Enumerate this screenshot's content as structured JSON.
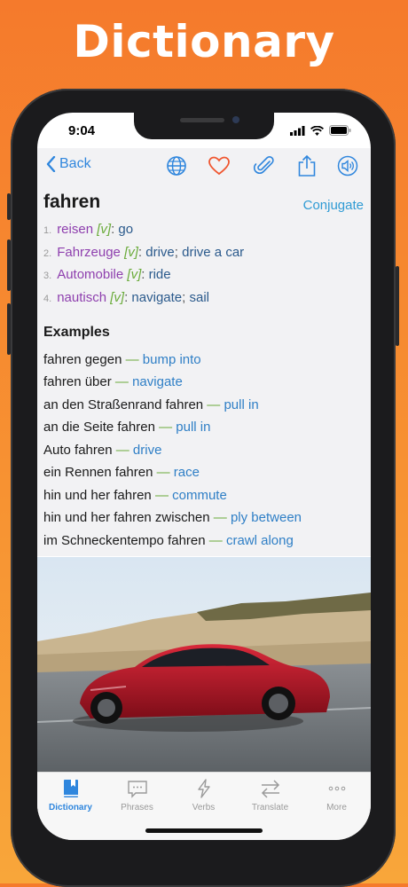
{
  "headline": "Dictionary",
  "status": {
    "time": "9:04"
  },
  "nav": {
    "back_label": "Back",
    "icons": [
      "globe-icon",
      "heart-icon",
      "paperclip-icon",
      "share-icon",
      "speaker-icon"
    ]
  },
  "entry": {
    "word": "fahren",
    "conjugate_label": "Conjugate",
    "senses": [
      {
        "num": "1.",
        "domain": "reisen",
        "pos": "[v]",
        "colon": ":",
        "translations": [
          "go"
        ]
      },
      {
        "num": "2.",
        "domain": "Fahrzeuge",
        "pos": "[v]",
        "colon": ":",
        "translations": [
          "drive",
          "drive a car"
        ]
      },
      {
        "num": "3.",
        "domain": "Automobile",
        "pos": "[v]",
        "colon": ":",
        "translations": [
          "ride"
        ]
      },
      {
        "num": "4.",
        "domain": "nautisch",
        "pos": "[v]",
        "colon": ":",
        "translations": [
          "navigate",
          "sail"
        ]
      }
    ],
    "sep": ";",
    "examples_title": "Examples",
    "dash": "—",
    "examples": [
      {
        "de": "fahren gegen",
        "en": "bump into"
      },
      {
        "de": "fahren über",
        "en": "navigate"
      },
      {
        "de": "an den Straßenrand fahren",
        "en": "pull in"
      },
      {
        "de": "an die Seite fahren",
        "en": "pull in"
      },
      {
        "de": "Auto fahren",
        "en": "drive"
      },
      {
        "de": "ein Rennen fahren",
        "en": "race"
      },
      {
        "de": "hin und her fahren",
        "en": "commute"
      },
      {
        "de": "hin und her fahren zwischen",
        "en": "ply between"
      },
      {
        "de": "im Schneckentempo fahren",
        "en": "crawl along"
      }
    ]
  },
  "tabs": [
    {
      "label": "Dictionary",
      "icon": "book-icon",
      "active": true
    },
    {
      "label": "Phrases",
      "icon": "chat-icon",
      "active": false
    },
    {
      "label": "Verbs",
      "icon": "bolt-icon",
      "active": false
    },
    {
      "label": "Translate",
      "icon": "swap-arrows-icon",
      "active": false
    },
    {
      "label": "More",
      "icon": "more-dots-icon",
      "active": false
    }
  ],
  "colors": {
    "accent": "#2f86dd",
    "background_top": "#f57a2c",
    "background_bottom": "#f8a63a",
    "domain": "#8e3fae",
    "pos": "#6aab3a",
    "translation": "#2b5a8c"
  }
}
